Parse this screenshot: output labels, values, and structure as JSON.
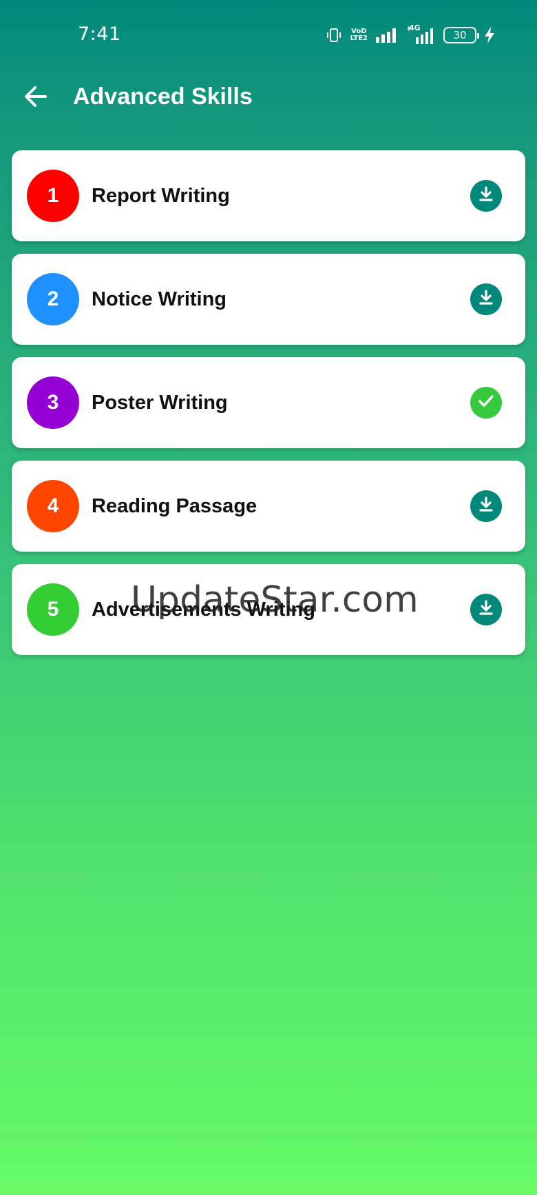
{
  "status_bar": {
    "time": "7:41",
    "volte_top": "VoD",
    "volte_bottom": "LTE2",
    "network_label": "4G",
    "battery_level": "30",
    "icons": [
      "vibrate-icon",
      "volte-icon",
      "signal-icon",
      "mobile-data-4g-icon",
      "battery-icon",
      "charging-icon"
    ]
  },
  "app_bar": {
    "title": "Advanced Skills",
    "back_icon": "arrow-left-icon"
  },
  "colors": {
    "app_bar_bg": "#00897b",
    "gradient_bottom": "#66fb66",
    "download_button": "#00897b",
    "done_button": "#35c93d"
  },
  "items": [
    {
      "number": "1",
      "title": "Report Writing",
      "color": "#ff0000",
      "status": "download",
      "status_icon": "download-icon"
    },
    {
      "number": "2",
      "title": "Notice Writing",
      "color": "#1e90ff",
      "status": "download",
      "status_icon": "download-icon"
    },
    {
      "number": "3",
      "title": "Poster Writing",
      "color": "#9400d3",
      "status": "downloaded",
      "status_icon": "check-icon"
    },
    {
      "number": "4",
      "title": "Reading Passage",
      "color": "#ff4500",
      "status": "download",
      "status_icon": "download-icon"
    },
    {
      "number": "5",
      "title": "Advertisements Writing",
      "color": "#32cd32",
      "status": "download",
      "status_icon": "download-icon"
    }
  ],
  "watermark": "UpdateStar.com"
}
